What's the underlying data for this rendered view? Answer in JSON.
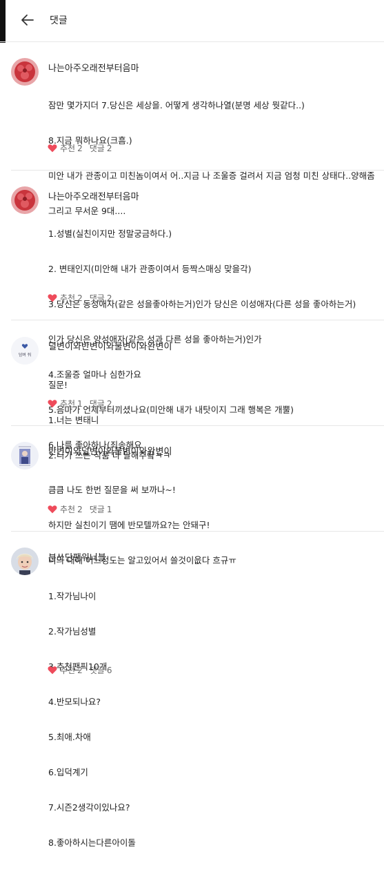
{
  "header": {
    "title": "댓글"
  },
  "comments": [
    {
      "author": "나는아주오래전부터음마",
      "lines": [
        "잠만 몇가지더 7.당신은 세상을. 어떻게 생각하나열(분명 세상 뭣같다..)",
        "8.지금 뭐하나요(크흠.)",
        "미안 내가 관종이고 미친놈이여서 어..지금 나 조울증 걸려서 지금 엄청 미친 상태다..양해좀",
        "그리고 무서운 9대...."
      ],
      "rec_label": "추천",
      "rec_count": "2",
      "reply_label": "댓글",
      "reply_count": "2",
      "avatar_icon": "red-flower-avatar"
    },
    {
      "author": "나는아주오래전부터음마",
      "lines": [
        "1.성별(실친이지만 정말궁금하다.)",
        "2. 변태인지(미안해 내가 관종이여서 등짝스매싱 맞을각)",
        "3.당신은 동성애자(같은 성을좋아하는거)인가 당신은 이성애자(다른 성을 좋아하는거)",
        "인가 당신은 양성애자(같은 성과 다른 성을 좋아하는거)인가",
        "4.조울증 얼마나 심한가요",
        "5.음마가 언제부터끼셨나요(미안해 내가 내탓이지 그래 행복은 개뿔)",
        "6.나를 좋아하나(죄송해요"
      ],
      "rec_label": "추천",
      "rec_count": "2",
      "reply_label": "댓글",
      "reply_count": "2",
      "avatar_icon": "red-flower-avatar"
    },
    {
      "author": "덜변이와반변이와불변이와완변이",
      "lines": [
        "질문!",
        "1.너는 변태니",
        "2.니가 쓰는 작품 다 말해주랔ㅋㅋ"
      ],
      "rec_label": "추천",
      "rec_count": "1",
      "reply_label": "댓글",
      "reply_count": "2",
      "avatar_icon": "small-heart-avatar",
      "avatar_text": "덤벼 줘"
    },
    {
      "author": "반변이와덜변이와불변이와완변이",
      "lines": [
        "큼큼 나도 한번 질문을 써 보까나~!",
        "하지만 실친이기 땜에 반모텔까요?는 안돼구!",
        "너의 대해 어느정도는 알고있어서 쓸것이읎다 흐규ㅠ"
      ],
      "rec_label": "추천",
      "rec_count": "2",
      "reply_label": "댓글",
      "reply_count": "1",
      "avatar_icon": "photo-card-avatar"
    },
    {
      "author": "분쏘단팬워너블",
      "lines": [
        "1.작가님나이",
        "2.작가님성별",
        "3.추천팬픽10개",
        "4.반모되나요?",
        "5.최애.차애",
        "6.입덕계기",
        "7.시즌2생각이있나요?",
        "8.좋아하시는다른아이돌"
      ],
      "rec_label": "추천",
      "rec_count": "2",
      "reply_label": "댓글",
      "reply_count": "6",
      "avatar_icon": "person-photo-avatar"
    }
  ],
  "colors": {
    "heart": "#ee4b5b",
    "divider": "#e6e6e6",
    "text": "#222222",
    "meta": "#666666"
  }
}
